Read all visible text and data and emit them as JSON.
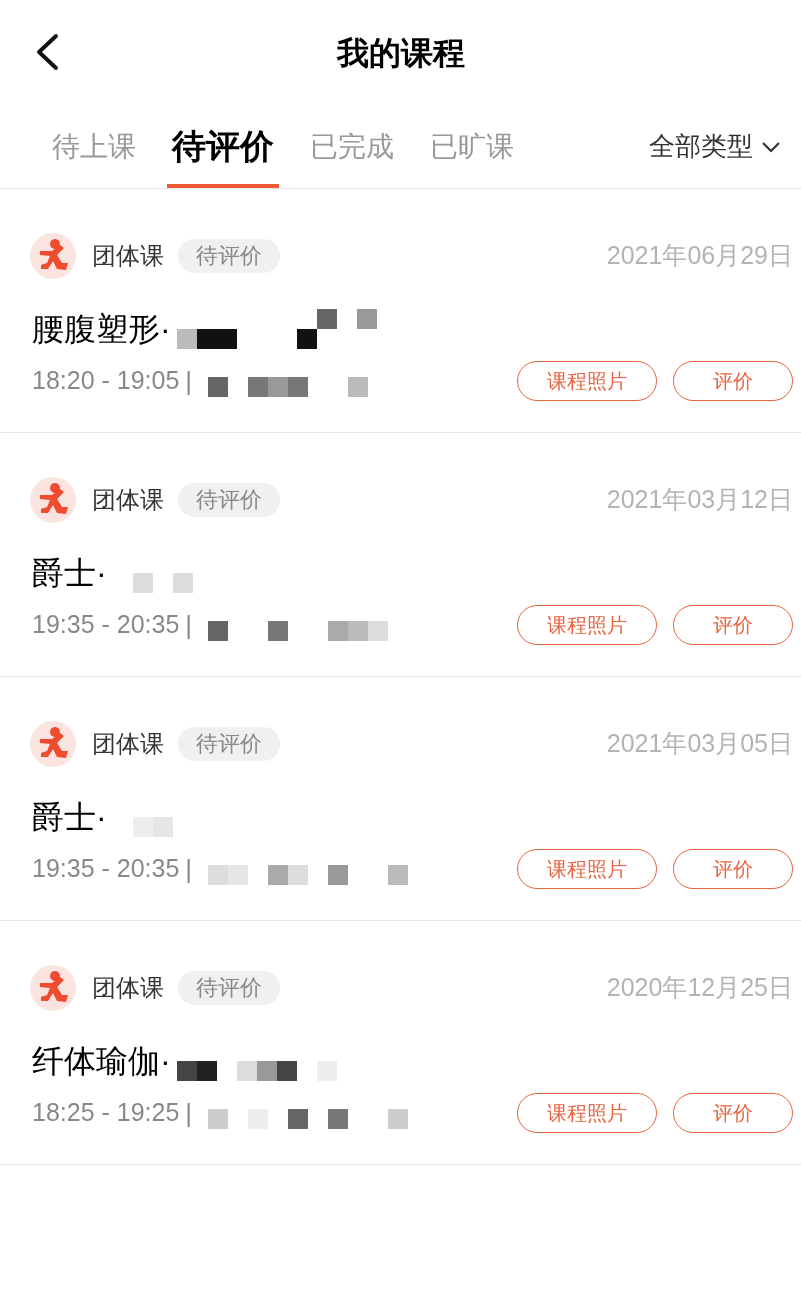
{
  "header": {
    "title": "我的课程"
  },
  "tabs": [
    {
      "label": "待上课",
      "selected": false
    },
    {
      "label": "待评价",
      "selected": true
    },
    {
      "label": "已完成",
      "selected": false
    },
    {
      "label": "已旷课",
      "selected": false
    }
  ],
  "filter": {
    "label": "全部类型"
  },
  "courses": [
    {
      "type": "团体课",
      "status": "待评价",
      "date": "2021年06月29日",
      "title": "腰腹塑形·",
      "time": "18:20 - 19:05",
      "separator": "|",
      "buttons": [
        "课程照片",
        "评价"
      ]
    },
    {
      "type": "团体课",
      "status": "待评价",
      "date": "2021年03月12日",
      "title": "爵士·",
      "time": "19:35 - 20:35",
      "separator": "|",
      "buttons": [
        "课程照片",
        "评价"
      ]
    },
    {
      "type": "团体课",
      "status": "待评价",
      "date": "2021年03月05日",
      "title": "爵士·",
      "time": "19:35 - 20:35",
      "separator": "|",
      "buttons": [
        "课程照片",
        "评价"
      ]
    },
    {
      "type": "团体课",
      "status": "待评价",
      "date": "2020年12月25日",
      "title": "纤体瑜伽·",
      "time": "18:25 - 19:25",
      "separator": "|",
      "buttons": [
        "课程照片",
        "评价"
      ]
    }
  ]
}
